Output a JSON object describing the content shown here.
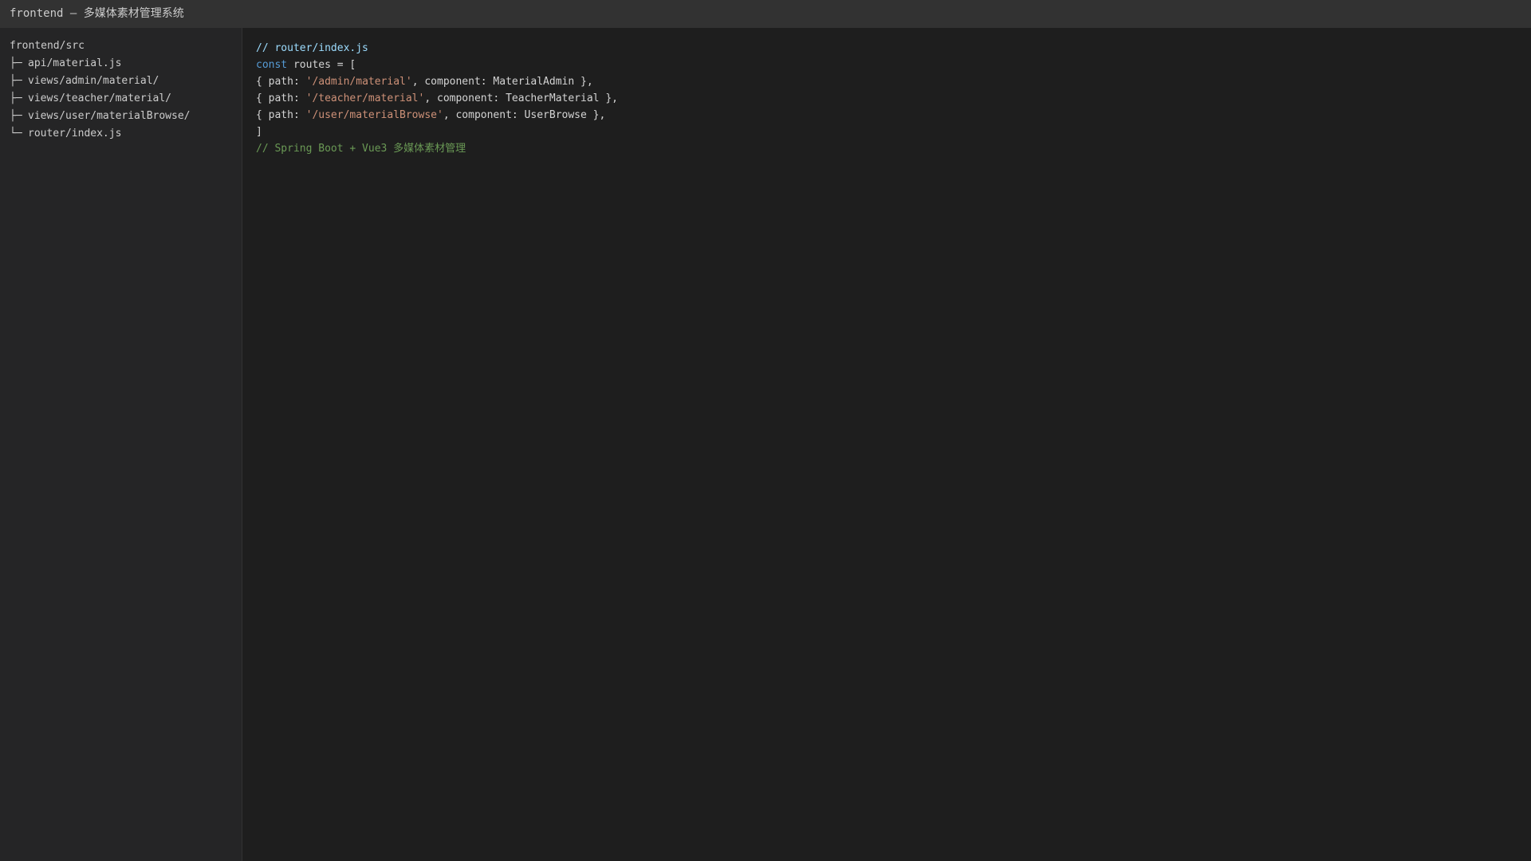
{
  "window": {
    "title": "frontend — 多媒体素材管理系统"
  },
  "sidebar": {
    "root": "frontend/src",
    "items": [
      {
        "glyph": "├─",
        "label": "api/material.js"
      },
      {
        "glyph": "├─",
        "label": "views/admin/material/"
      },
      {
        "glyph": "├─",
        "label": "views/teacher/material/"
      },
      {
        "glyph": "├─",
        "label": "views/user/materialBrowse/"
      },
      {
        "glyph": "└─",
        "label": "router/index.js"
      }
    ]
  },
  "editor": {
    "file_comment": "// router/index.js",
    "const_kw": "const",
    "const_rest": " routes = [",
    "routes": [
      {
        "pre": "{ path: ",
        "path": "'/admin/material'",
        "post": ", component: MaterialAdmin },"
      },
      {
        "pre": "{ path: ",
        "path": "'/teacher/material'",
        "post": ", component: TeacherMaterial },"
      },
      {
        "pre": "{ path: ",
        "path": "'/user/materialBrowse'",
        "post": ", component: UserBrowse },"
      }
    ],
    "close": "]",
    "footer_comment": "// Spring Boot + Vue3 多媒体素材管理"
  },
  "colors": {
    "comment_blue": "#9cdcfe",
    "keyword": "#569cd6",
    "string": "#ce9178",
    "comment_green": "#6a9955"
  }
}
